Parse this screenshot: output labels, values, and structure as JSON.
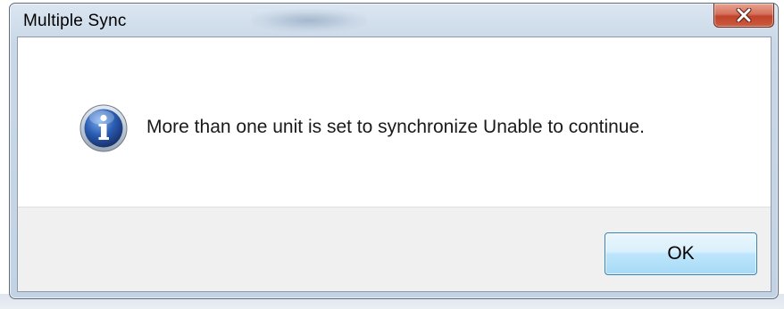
{
  "dialog": {
    "title": "Multiple Sync",
    "message": "More than one unit is set to synchronize Unable to continue.",
    "icon": "info-icon",
    "close_icon": "close-icon",
    "ok_label": "OK"
  },
  "colors": {
    "close_button": "#c7503a",
    "ok_button_border": "#3c7fb1",
    "info_icon_blue": "#2a5db3"
  }
}
